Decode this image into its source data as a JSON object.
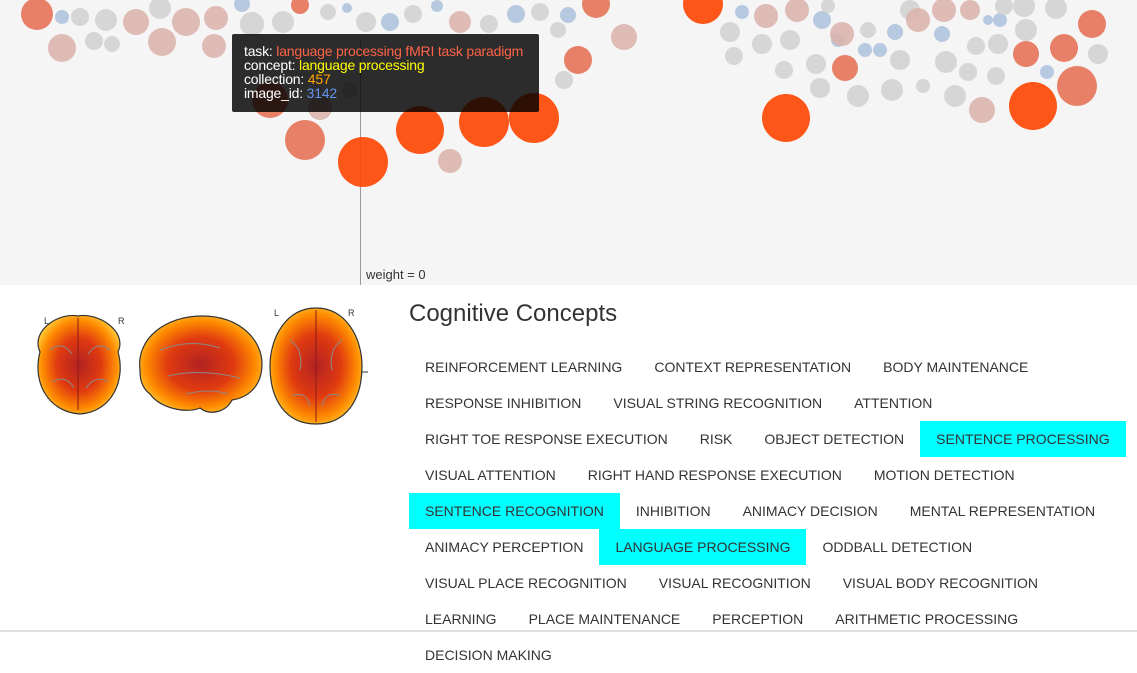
{
  "tooltip": {
    "task_label": "task:",
    "task_value": "language processing fMRI task paradigm",
    "concept_label": "concept:",
    "concept_value": "language processing",
    "collection_label": "collection:",
    "collection_value": "457",
    "image_id_label": "image_id:",
    "image_id_value": "3142"
  },
  "weight_label": "weight = 0",
  "brain": {
    "left_marker_1": "L",
    "right_marker_1": "R",
    "left_marker_2": "L",
    "right_marker_2": "R"
  },
  "concepts": {
    "title": "Cognitive Concepts",
    "items": [
      {
        "label": "REINFORCEMENT LEARNING",
        "active": false
      },
      {
        "label": "CONTEXT REPRESENTATION",
        "active": false
      },
      {
        "label": "BODY MAINTENANCE",
        "active": false
      },
      {
        "label": "RESPONSE INHIBITION",
        "active": false
      },
      {
        "label": "VISUAL STRING RECOGNITION",
        "active": false
      },
      {
        "label": "ATTENTION",
        "active": false
      },
      {
        "label": "RIGHT TOE RESPONSE EXECUTION",
        "active": false
      },
      {
        "label": "RISK",
        "active": false
      },
      {
        "label": "OBJECT DETECTION",
        "active": false
      },
      {
        "label": "SENTENCE PROCESSING",
        "active": true
      },
      {
        "label": "VISUAL ATTENTION",
        "active": false
      },
      {
        "label": "RIGHT HAND RESPONSE EXECUTION",
        "active": false
      },
      {
        "label": "MOTION DETECTION",
        "active": false
      },
      {
        "label": "SENTENCE RECOGNITION",
        "active": true
      },
      {
        "label": "INHIBITION",
        "active": false
      },
      {
        "label": "ANIMACY DECISION",
        "active": false
      },
      {
        "label": "MENTAL REPRESENTATION",
        "active": false
      },
      {
        "label": "ANIMACY PERCEPTION",
        "active": false
      },
      {
        "label": "LANGUAGE PROCESSING",
        "active": true
      },
      {
        "label": "ODDBALL DETECTION",
        "active": false
      },
      {
        "label": "VISUAL PLACE RECOGNITION",
        "active": false
      },
      {
        "label": "VISUAL RECOGNITION",
        "active": false
      },
      {
        "label": "VISUAL BODY RECOGNITION",
        "active": false
      },
      {
        "label": "LEARNING",
        "active": false
      },
      {
        "label": "PLACE MAINTENANCE",
        "active": false
      },
      {
        "label": "PERCEPTION",
        "active": false
      },
      {
        "label": "ARITHMETIC PROCESSING",
        "active": false
      },
      {
        "label": "DECISION MAKING",
        "active": false
      }
    ]
  },
  "colors": {
    "background": "#f5f5f5",
    "active_concept": "#00ffff",
    "tooltip_task": "#ff6347",
    "tooltip_concept": "#ffff00",
    "tooltip_collection": "#ffa500",
    "tooltip_image_id": "#6495ed",
    "bubble_strong": "#ff4500",
    "bubble_medium": "#e57357",
    "bubble_weak": "#dcb5ad",
    "bubble_neutral": "#d3d3d3",
    "bubble_negative": "#b0c4de"
  }
}
